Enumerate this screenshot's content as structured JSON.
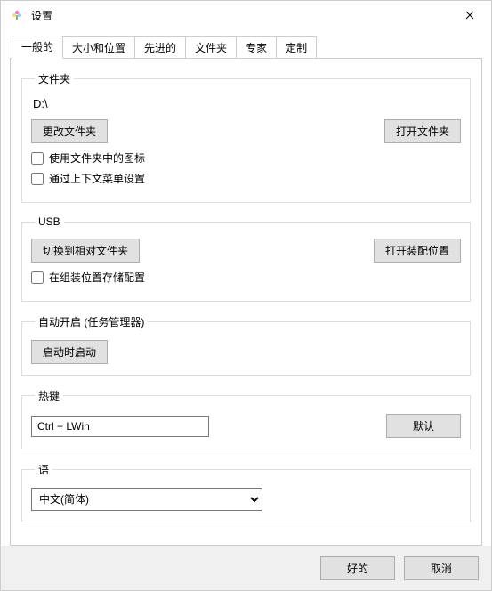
{
  "window": {
    "title": "设置"
  },
  "tabs": {
    "general": "一般的",
    "size_position": "大小和位置",
    "advanced": "先进的",
    "folders": "文件夹",
    "expert": "专家",
    "custom": "定制"
  },
  "group_folder": {
    "legend": "文件夹",
    "path": "D:\\",
    "change_folder_btn": "更改文件夹",
    "open_folder_btn": "打开文件夹",
    "use_icons_label": "使用文件夹中的图标",
    "via_context_label": "通过上下文菜单设置"
  },
  "group_usb": {
    "legend": "USB",
    "switch_relative_btn": "切换到相对文件夹",
    "open_assembly_btn": "打开装配位置",
    "store_config_label": "在组装位置存储配置"
  },
  "group_autostart": {
    "legend": "自动开启 (任务管理器)",
    "startup_btn": "启动时启动"
  },
  "group_hotkey": {
    "legend": "热键",
    "value": "Ctrl + LWin",
    "default_btn": "默认"
  },
  "group_language": {
    "legend": "语",
    "selected": "中文(简体)"
  },
  "footer": {
    "ok": "好的",
    "cancel": "取消"
  }
}
